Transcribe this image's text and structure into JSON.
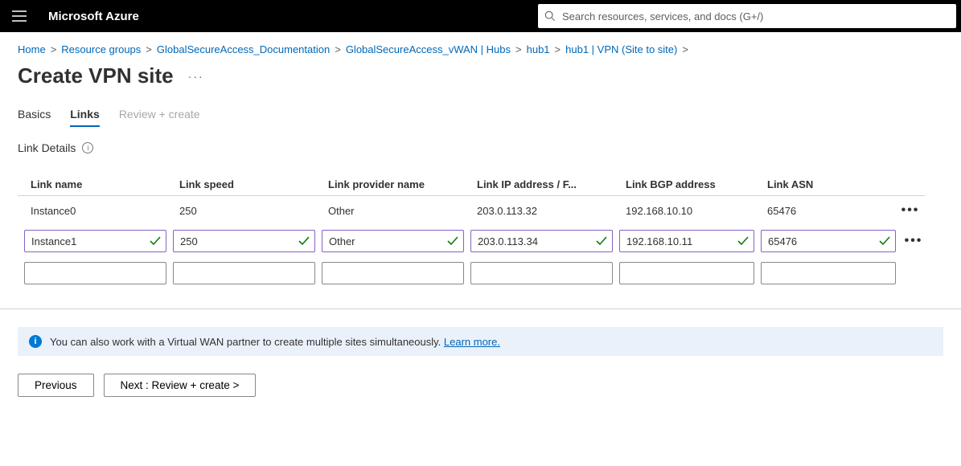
{
  "header": {
    "brand": "Microsoft Azure",
    "search_placeholder": "Search resources, services, and docs (G+/)"
  },
  "breadcrumb": {
    "items": [
      "Home",
      "Resource groups",
      "GlobalSecureAccess_Documentation",
      "GlobalSecureAccess_vWAN | Hubs",
      "hub1",
      "hub1 | VPN (Site to site)"
    ]
  },
  "page_title": "Create VPN site",
  "tabs": {
    "basics": "Basics",
    "links": "Links",
    "review": "Review + create"
  },
  "section_label": "Link Details",
  "columns": {
    "name": "Link name",
    "speed": "Link speed",
    "provider": "Link provider name",
    "ip": "Link IP address / F...",
    "bgp": "Link BGP address",
    "asn": "Link ASN"
  },
  "rows": {
    "static": {
      "name": "Instance0",
      "speed": "250",
      "provider": "Other",
      "ip": "203.0.113.32",
      "bgp": "192.168.10.10",
      "asn": "65476"
    },
    "editing": {
      "name": "Instance1",
      "speed": "250",
      "provider": "Other",
      "ip": "203.0.113.34",
      "bgp": "192.168.10.11",
      "asn": "65476"
    }
  },
  "info": {
    "text": "You can also work with a Virtual WAN partner to create multiple sites simultaneously. ",
    "link": "Learn more."
  },
  "buttons": {
    "previous": "Previous",
    "next": "Next : Review + create >"
  }
}
